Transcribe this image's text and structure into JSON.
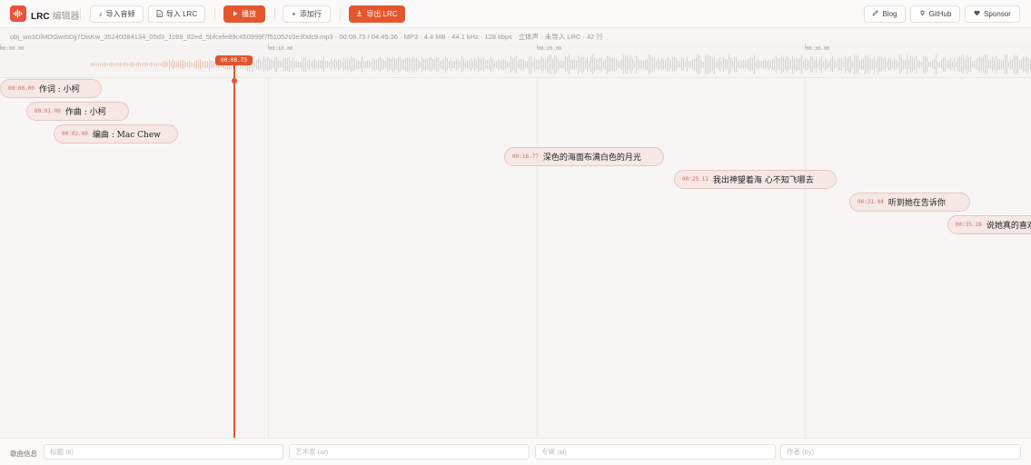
{
  "app": {
    "title": "LRC",
    "subtitle": "编辑器"
  },
  "toolbar": {
    "import_audio": "导入音频",
    "import_lrc": "导入 LRC",
    "play": "播放",
    "add_line": "添加行",
    "export_lrc": "导出 LRC",
    "blog": "Blog",
    "github": "GitHub",
    "sponsor": "Sponsor"
  },
  "info": {
    "text": "obj_wo3DlMOGwrbDjj7DisKw_35240084134_05d3_1c69_82ed_5bfcefe89c450999f7f51052c0e30dc9.mp3  ·  00:08.73 / 04:45.36  ·  MP3 · 4.4 MB · 44.1 kHz · 128 kbps · 立体声  ·  未导入 LRC  ·  42 行"
  },
  "ruler": {
    "ticks": [
      "00:00.00",
      "00:10.00",
      "00:20.00",
      "00:30.00"
    ]
  },
  "playhead": {
    "time": "00:08.73"
  },
  "lyrics": [
    {
      "time": "00:00.00",
      "text": "作词 : 小柯"
    },
    {
      "time": "00:01.00",
      "text": "作曲 : 小柯"
    },
    {
      "time": "00:02.00",
      "text": "编曲 : Mac Chew"
    },
    {
      "time": "00:18.77",
      "text": "深色的海面布满白色的月光"
    },
    {
      "time": "00:25.11",
      "text": "我出神望着海 心不知飞哪去"
    },
    {
      "time": "00:31.04",
      "text": "听到她在告诉你"
    },
    {
      "time": "00:35.28",
      "text": "说她真的喜欢你"
    }
  ],
  "footer": {
    "label": "歌曲信息",
    "title_placeholder": "标题 (ti)",
    "artist_placeholder": "艺术家 (ar)",
    "album_placeholder": "专辑 (al)",
    "author_placeholder": "作者 (by)"
  },
  "colors": {
    "accent": "#e4572e",
    "pill_bg": "#f6e8e4",
    "pill_border": "#eac7c0"
  }
}
